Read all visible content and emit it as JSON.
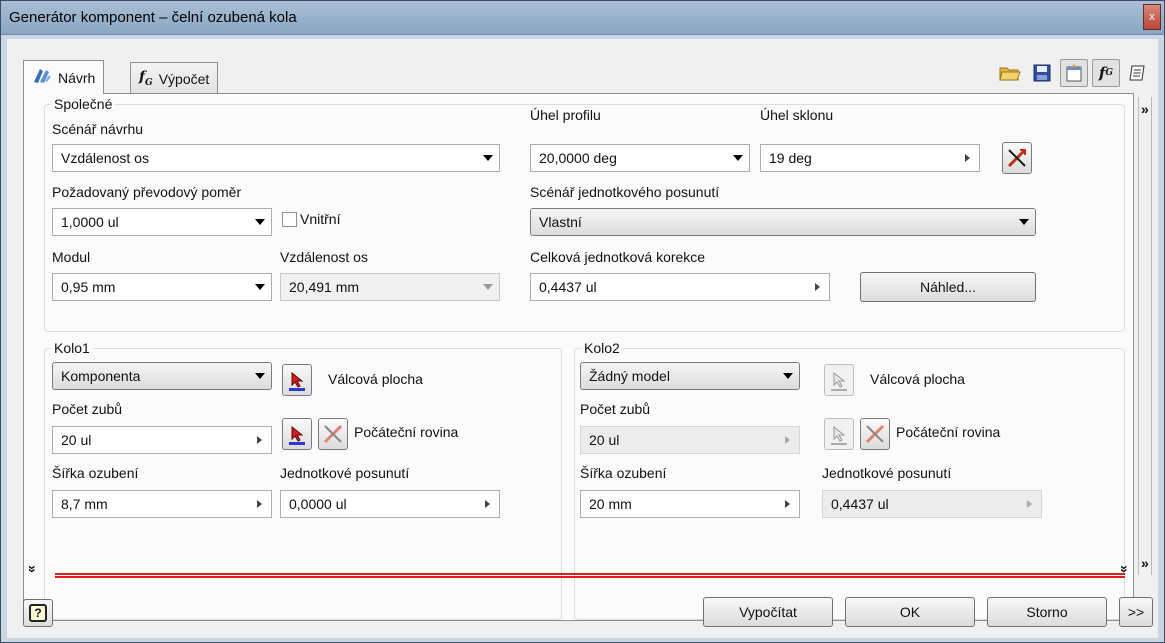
{
  "window": {
    "title": "Generátor komponent – čelní ozubená kola",
    "close_glyph": "x"
  },
  "tabs": [
    {
      "label": "Návrh",
      "active": true
    },
    {
      "label": "Výpočet",
      "active": false
    }
  ],
  "toolbar_icons": [
    "open-folder-icon",
    "save-icon",
    "options-icon",
    "function-icon",
    "notes-icon"
  ],
  "chevrons": {
    "expand": "»",
    "collapse": "»",
    "down": "»"
  },
  "common": {
    "legend": "Společné",
    "scenario_label": "Scénář návrhu",
    "scenario_value": "Vzdálenost os",
    "ratio_label": "Požadovaný převodový poměr",
    "ratio_value": "1,0000 ul",
    "internal_label": "Vnitřní",
    "module_label": "Modul",
    "module_value": "0,95 mm",
    "center_distance_label": "Vzdálenost os",
    "center_distance_value": "20,491 mm",
    "pressure_angle_label": "Úhel profilu",
    "pressure_angle_value": "20,0000 deg",
    "helix_angle_label": "Úhel sklonu",
    "helix_angle_value": "19 deg",
    "shift_scenario_label": "Scénář jednotkového posunutí",
    "shift_scenario_value": "Vlastní",
    "total_correction_label": "Celková jednotková korekce",
    "total_correction_value": "0,4437 ul",
    "preview_button": "Náhled..."
  },
  "gear1": {
    "legend": "Kolo1",
    "type_value": "Komponenta",
    "cylindrical_face_label": "Válcová plocha",
    "teeth_label": "Počet zubů",
    "teeth_value": "20 ul",
    "start_plane_label": "Počáteční rovina",
    "face_width_label": "Šířka ozubení",
    "face_width_value": "8,7 mm",
    "unit_shift_label": "Jednotkové posunutí",
    "unit_shift_value": "0,0000 ul"
  },
  "gear2": {
    "legend": "Kolo2",
    "type_value": "Žádný model",
    "cylindrical_face_label": "Válcová plocha",
    "teeth_label": "Počet zubů",
    "teeth_value": "20 ul",
    "start_plane_label": "Počáteční rovina",
    "face_width_label": "Šířka ozubení",
    "face_width_value": "20 mm",
    "unit_shift_label": "Jednotkové posunutí",
    "unit_shift_value": "0,4437 ul"
  },
  "footer": {
    "help_glyph": "?",
    "calculate": "Vypočítat",
    "ok": "OK",
    "cancel": "Storno",
    "more": ">>"
  }
}
